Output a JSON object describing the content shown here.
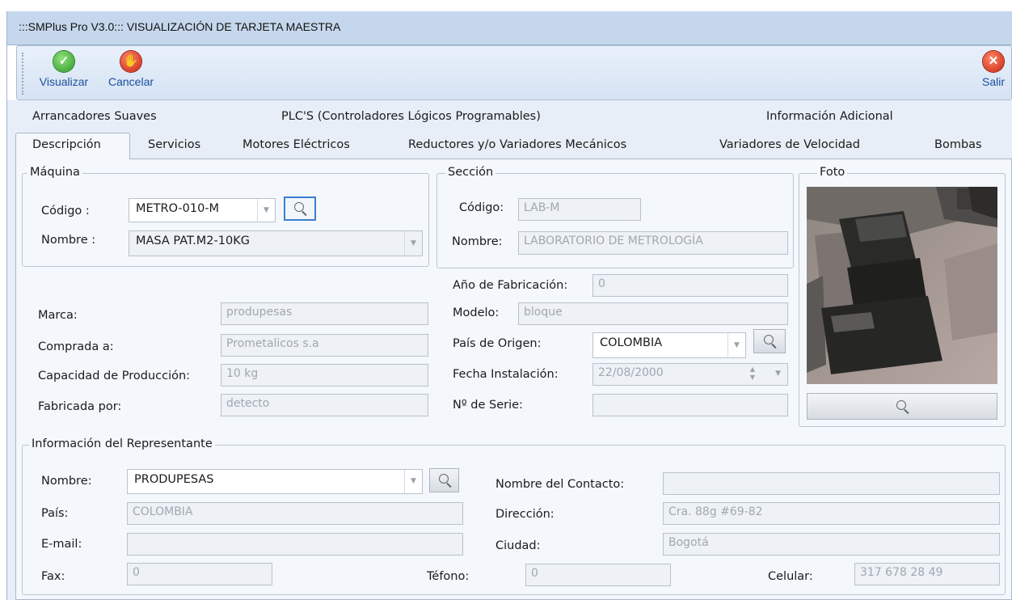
{
  "window": {
    "title": ":::SMPlus Pro V3.0::: VISUALIZACIÓN DE TARJETA MAESTRA"
  },
  "toolbar": {
    "visualizar_label": "Visualizar",
    "cancelar_label": "Cancelar",
    "salir_label": "Salir",
    "visualizar_icon": "checkmark-icon",
    "cancelar_icon": "stop-hand-icon",
    "salir_icon": "close-icon"
  },
  "tabs": {
    "row_top": [
      "Arrancadores Suaves",
      "PLC'S (Controladores Lógicos Programables)",
      "Información Adicional"
    ],
    "row_bottom": [
      "Descripción",
      "Servicios",
      "Motores Eléctricos",
      "Reductores y/o Variadores Mecánicos",
      "Variadores de Velocidad",
      "Bombas"
    ],
    "active": "Descripción"
  },
  "maquina": {
    "group_label": "Máquina",
    "codigo_label": "Código :",
    "codigo_value": "METRO-010-M",
    "nombre_label": "Nombre :",
    "nombre_value": "MASA PAT.M2-10KG"
  },
  "seccion": {
    "group_label": "Sección",
    "codigo_label": "Código:",
    "codigo_value": "LAB-M",
    "nombre_label": "Nombre:",
    "nombre_value": "LABORATORIO DE METROLOGÍA"
  },
  "foto": {
    "group_label": "Foto"
  },
  "details": {
    "marca_label": "Marca:",
    "marca_value": "produpesas",
    "comprada_label": "Comprada a:",
    "comprada_value": "Prometalicos s.a",
    "capacidad_label": "Capacidad de Producción:",
    "capacidad_value": "10 kg",
    "fabricada_label": "Fabricada por:",
    "fabricada_value": "detecto",
    "anio_label": "Año de Fabricación:",
    "anio_value": "0",
    "modelo_label": "Modelo:",
    "modelo_value": "bloque",
    "pais_label": "País de Origen:",
    "pais_value": "COLOMBIA",
    "fecha_label": "Fecha Instalación:",
    "fecha_value": "22/08/2000",
    "serie_label": "Nº de Serie:",
    "serie_value": ""
  },
  "representante": {
    "group_label": "Información del Representante",
    "nombre_label": "Nombre:",
    "nombre_value": "PRODUPESAS",
    "pais_label": "País:",
    "pais_value": "COLOMBIA",
    "email_label": "E-mail:",
    "email_value": "",
    "fax_label": "Fax:",
    "fax_value": "0",
    "contacto_label": "Nombre del  Contacto:",
    "contacto_value": "",
    "direccion_label": "Dirección:",
    "direccion_value": "Cra. 88g #69-82",
    "ciudad_label": "Ciudad:",
    "ciudad_value": "Bogotá",
    "telefono_label": "Téfono:",
    "telefono_value": "0",
    "celular_label": "Celular:",
    "celular_value": "317 678 28 49"
  },
  "colors": {
    "titlebar": "#c5d7ec",
    "form_background": "#e7eef7",
    "accent_blue": "#1a4f9c",
    "focus_blue": "#3b7fd0"
  }
}
